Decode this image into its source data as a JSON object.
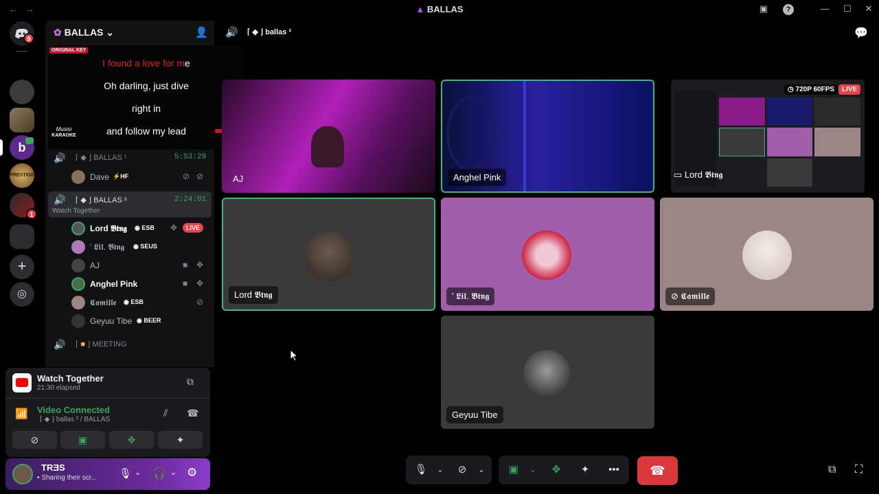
{
  "window": {
    "title": "BALLAS",
    "back_glyph": "←",
    "forward_glyph": "→"
  },
  "rail": {
    "home_badge": "9",
    "server_badge": "1",
    "prestige_label": "PRESTIGE"
  },
  "server": {
    "name": "BALLAS ⌄"
  },
  "karaoke": {
    "tag": "ORIGINAL KEY",
    "line1_sung": "I found a love for m",
    "line1_rest": "e",
    "line2": "Oh darling, just dive",
    "line3": "right in",
    "line4": "and follow my lead",
    "brand_top": "Musisi",
    "brand_bottom": "KARAOKE"
  },
  "channels": {
    "ch1": {
      "name": "BALLAS ¹",
      "timer": "5:53:29"
    },
    "ch1_users": [
      {
        "name": "Dave",
        "tag": "⚡HF"
      }
    ],
    "ch2": {
      "name": "BALLAS ²",
      "timer": "2:24:01",
      "activity": "Watch Together"
    },
    "ch2_users": [
      {
        "name": "Lord 𝕭𝖙𝖓𝖌",
        "tag": "ESB",
        "live": "LIVE"
      },
      {
        "name": "' 𝕷𝖎𝖑. 𝕭𝖙𝖓𝖌",
        "tag": "SEUS"
      },
      {
        "name": "AJ",
        "tag": ""
      },
      {
        "name": "Anghel Pink",
        "tag": ""
      },
      {
        "name": "𝕮𝖆𝖒𝖎𝖑𝖑𝖊",
        "tag": "ESB"
      },
      {
        "name": "Geyuu Tibe",
        "tag": "BEER"
      }
    ],
    "ch3": {
      "name": "MEETING"
    }
  },
  "activity": {
    "title": "Watch Together",
    "elapsed": "21:30 elapsed"
  },
  "voice": {
    "status": "Video Connected",
    "location": "ballas ² / BALLAS"
  },
  "user": {
    "name": "TRƎS",
    "status": "Sharing their scr..."
  },
  "header": {
    "channel": "ballas ²"
  },
  "tiles": [
    {
      "name": "AJ"
    },
    {
      "name": "Anghel Pink"
    },
    {
      "name": "Lord 𝕭𝖙𝖓𝖌",
      "stream_quality": "720P 60FPS",
      "live": "LIVE"
    },
    {
      "name": "Lord 𝕭𝖙𝖓𝖌"
    },
    {
      "name": "' 𝕷𝖎𝖑. 𝕭𝖙𝖓𝖌"
    },
    {
      "name": "𝕮𝖆𝖒𝖎𝖑𝖑𝖊"
    },
    {
      "name": "Geyuu Tibe"
    }
  ],
  "colors": {
    "accent_green": "#3ba55d",
    "danger_red": "#da373c",
    "live_red": "#ed4245",
    "speaking_border": "#43b581",
    "tile_purple": "#a05ea8",
    "tile_mauve": "#9b8585",
    "tile_grey": "#3a3a3a"
  },
  "icons": [
    "discord-icon",
    "speaker-icon",
    "mic-icon",
    "headphones-icon",
    "settings-icon",
    "camera-off-icon",
    "screen-share-icon",
    "activity-icon",
    "soundboard-icon",
    "more-icon",
    "hangup-icon",
    "popout-icon",
    "fullscreen-icon",
    "chat-icon",
    "add-member-icon",
    "plus-icon",
    "compass-icon"
  ]
}
